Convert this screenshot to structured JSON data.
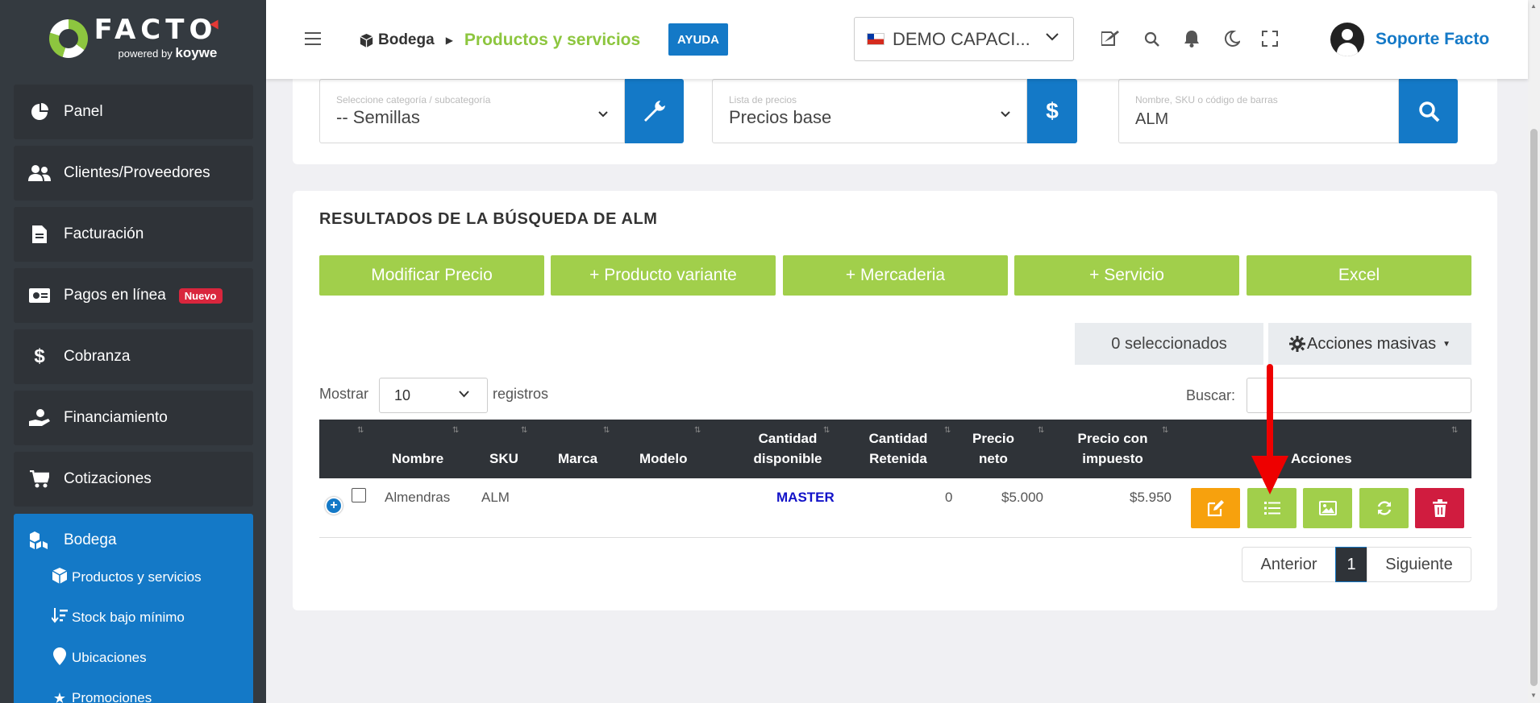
{
  "brand": {
    "name": "FACTO",
    "powered": "powered",
    "by": "by",
    "partner": "koywe"
  },
  "sidebar": {
    "items": [
      {
        "label": "Panel",
        "icon": "pie-chart-icon"
      },
      {
        "label": "Clientes/Proveedores",
        "icon": "users-icon"
      },
      {
        "label": "Facturación",
        "icon": "document-icon"
      },
      {
        "label": "Pagos en línea",
        "icon": "money-bill-icon",
        "badge": "Nuevo"
      },
      {
        "label": "Cobranza",
        "icon": "dollar-icon"
      },
      {
        "label": "Financiamiento",
        "icon": "hand-coin-icon"
      },
      {
        "label": "Cotizaciones",
        "icon": "cart-icon"
      }
    ],
    "active": {
      "label": "Bodega",
      "icon": "boxes-icon",
      "children": [
        {
          "label": "Productos y servicios",
          "icon": "box-icon"
        },
        {
          "label": "Stock bajo mínimo",
          "icon": "sort-down-icon"
        },
        {
          "label": "Ubicaciones",
          "icon": "map-pin-icon"
        },
        {
          "label": "Promociones",
          "icon": "star-icon"
        }
      ]
    }
  },
  "topbar": {
    "breadcrumb_home": "Bodega",
    "breadcrumb_current": "Productos y servicios",
    "help_label": "AYUDA",
    "company": "DEMO CAPACI...",
    "user_name": "Soporte Facto",
    "icons": [
      "sign-document-icon",
      "search-icon",
      "bell-icon",
      "moon-icon",
      "fullscreen-icon"
    ]
  },
  "filters": {
    "category": {
      "label": "Seleccione categoría / subcategoría",
      "value": "-- Semillas"
    },
    "price_list": {
      "label": "Lista de precios",
      "value": "Precios base"
    },
    "search": {
      "label": "Nombre, SKU o código de barras",
      "value": "ALM"
    }
  },
  "results": {
    "title": "RESULTADOS DE LA BÚSQUEDA DE ALM",
    "actions": [
      "Modificar Precio",
      "+ Producto variante",
      "+ Mercaderia",
      "+ Servicio",
      "Excel"
    ],
    "selected_count": "0 seleccionados",
    "mass_actions": "Acciones masivas",
    "show_label": "Mostrar",
    "page_length": "10",
    "records_label": "registros",
    "search_label": "Buscar:",
    "columns": {
      "nombre": "Nombre",
      "sku": "SKU",
      "marca": "Marca",
      "modelo": "Modelo",
      "cantidad_disponible_1": "Cantidad",
      "cantidad_disponible_2": "disponible",
      "cantidad_retenida_1": "Cantidad",
      "cantidad_retenida_2": "Retenida",
      "precio_neto_1": "Precio",
      "precio_neto_2": "neto",
      "precio_impuesto_1": "Precio con",
      "precio_impuesto_2": "impuesto",
      "acciones": "Acciones"
    },
    "rows": [
      {
        "nombre": "Almendras",
        "sku": "ALM",
        "marca": "",
        "modelo": "",
        "cantidad_disponible": "MASTER",
        "cantidad_retenida": "0",
        "precio_neto": "$5.000",
        "precio_impuesto": "$5.950"
      }
    ],
    "row_action_icons": [
      "edit-icon",
      "list-icon",
      "image-icon",
      "refresh-icon",
      "trash-icon"
    ],
    "pagination": {
      "prev": "Anterior",
      "page": "1",
      "next": "Siguiente"
    }
  },
  "colors": {
    "sidebar_bg": "#343a40",
    "active_blue": "#1479c7",
    "action_green": "#a1cf4b",
    "edit_orange": "#f7a10d",
    "delete_red": "#d01c3f",
    "annotation_red": "#e00000"
  }
}
